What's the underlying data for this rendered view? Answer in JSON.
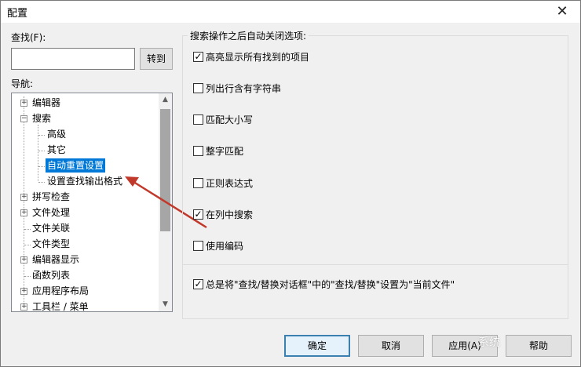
{
  "window": {
    "title": "配置",
    "close_glyph": "✕"
  },
  "find": {
    "label": "查找(F):",
    "value": "",
    "go_button": "转到"
  },
  "nav": {
    "label": "导航:",
    "items": [
      {
        "label": "编辑器",
        "expander": "+"
      },
      {
        "label": "搜索",
        "expander": "−"
      },
      {
        "label": "高级"
      },
      {
        "label": "其它"
      },
      {
        "label": "自动重置设置",
        "selected": true
      },
      {
        "label": "设置查找输出格式"
      },
      {
        "label": "拼写检查",
        "expander": "+"
      },
      {
        "label": "文件处理",
        "expander": "+"
      },
      {
        "label": "文件关联"
      },
      {
        "label": "文件类型"
      },
      {
        "label": "编辑器显示",
        "expander": "+"
      },
      {
        "label": "函数列表"
      },
      {
        "label": "应用程序布局",
        "expander": "+"
      },
      {
        "label": "工具栏 / 菜单",
        "expander": "+"
      }
    ],
    "scroll_up": "▲",
    "scroll_down": "▼"
  },
  "options": {
    "group_title": "搜索操作之后自动关闭选项:",
    "items": [
      {
        "label": "高亮显示所有找到的项目",
        "checked": true
      },
      {
        "label": "列出行含有字符串",
        "checked": false
      },
      {
        "label": "匹配大小写",
        "checked": false
      },
      {
        "label": "整字匹配",
        "checked": false
      },
      {
        "label": "正则表达式",
        "checked": false
      },
      {
        "label": "在列中搜索",
        "checked": true
      },
      {
        "label": "使用编码",
        "checked": false
      }
    ],
    "always_option": {
      "label": "总是将\"查找/替换对话框\"中的\"查找/替换\"设置为\"当前文件\"",
      "checked": true
    },
    "check_glyph": "✓"
  },
  "buttons": {
    "ok": "确定",
    "cancel": "取消",
    "apply": "应用(A)",
    "help": "帮助"
  },
  "watermark": "系统"
}
